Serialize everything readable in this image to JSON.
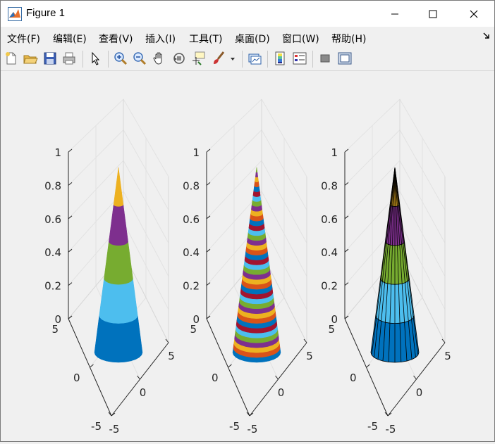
{
  "window": {
    "title": "Figure 1"
  },
  "menu": [
    {
      "label": "文件(F)"
    },
    {
      "label": "编辑(E)"
    },
    {
      "label": "查看(V)"
    },
    {
      "label": "插入(I)"
    },
    {
      "label": "工具(T)"
    },
    {
      "label": "桌面(D)"
    },
    {
      "label": "窗口(W)"
    },
    {
      "label": "帮助(H)"
    }
  ],
  "toolbar": [
    {
      "icon": "new-figure-icon"
    },
    {
      "icon": "open-file-icon"
    },
    {
      "icon": "save-icon"
    },
    {
      "icon": "print-icon"
    },
    {
      "icon": "pointer-icon"
    },
    {
      "icon": "zoom-in-icon"
    },
    {
      "icon": "zoom-out-icon"
    },
    {
      "icon": "pan-hand-icon"
    },
    {
      "icon": "rotate-3d-icon"
    },
    {
      "icon": "data-cursor-icon"
    },
    {
      "icon": "brush-icon"
    },
    {
      "icon": "link-plot-icon"
    },
    {
      "icon": "colorbar-icon"
    },
    {
      "icon": "legend-icon"
    },
    {
      "icon": "hide-plot-tools-icon"
    },
    {
      "icon": "show-plot-tools-icon"
    }
  ],
  "chart_data": [
    {
      "type": "surface",
      "shape": "cone",
      "zlim": [
        0,
        1
      ],
      "xlim": [
        -5,
        5
      ],
      "ylim": [
        -5,
        5
      ],
      "ztick_labels": [
        "0",
        "0.2",
        "0.4",
        "0.6",
        "0.8",
        "1"
      ],
      "xtick_labels": [
        "-5",
        "0",
        "5"
      ],
      "ytick_labels": [
        "-5",
        "0",
        "5"
      ],
      "edge_lines": false,
      "band_count": 5,
      "band_colors": [
        "#0072bd",
        "#4dbeee",
        "#77ac30",
        "#7e2f8e",
        "#edb120"
      ],
      "grid": true
    },
    {
      "type": "surface",
      "shape": "cone",
      "zlim": [
        0,
        1
      ],
      "xlim": [
        -5,
        5
      ],
      "ylim": [
        -5,
        5
      ],
      "ztick_labels": [
        "0",
        "0.2",
        "0.4",
        "0.6",
        "0.8",
        "1"
      ],
      "xtick_labels": [
        "-5",
        "0",
        "5"
      ],
      "ytick_labels": [
        "-5",
        "0",
        "5"
      ],
      "edge_lines": false,
      "band_count": 40,
      "band_colors": [
        "#0072bd",
        "#d95319",
        "#edb120",
        "#7e2f8e",
        "#77ac30",
        "#4dbeee",
        "#a2142f"
      ],
      "grid": true
    },
    {
      "type": "surface",
      "shape": "cone",
      "zlim": [
        0,
        1
      ],
      "xlim": [
        -5,
        5
      ],
      "ylim": [
        -5,
        5
      ],
      "ztick_labels": [
        "0",
        "0.2",
        "0.4",
        "0.6",
        "0.8",
        "1"
      ],
      "xtick_labels": [
        "-5",
        "0",
        "5"
      ],
      "ytick_labels": [
        "-5",
        "0",
        "5"
      ],
      "edge_lines": true,
      "band_count": 5,
      "band_colors": [
        "#0072bd",
        "#4dbeee",
        "#77ac30",
        "#7e2f8e",
        "#edb120"
      ],
      "grid": true
    }
  ]
}
